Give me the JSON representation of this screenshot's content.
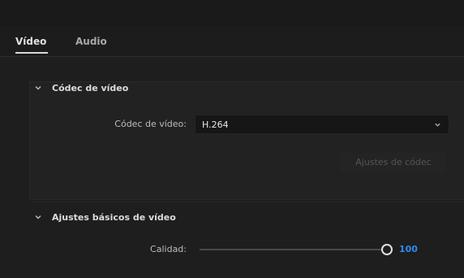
{
  "tabs": [
    {
      "label": "Vídeo",
      "active": true
    },
    {
      "label": "Audio",
      "active": false
    }
  ],
  "codec_section": {
    "title": "Códec de vídeo",
    "field_label": "Códec de vídeo:",
    "field_value": "H.264",
    "settings_button": "Ajustes de códec"
  },
  "basic_section": {
    "title": "Ajustes básicos de vídeo",
    "quality_label": "Calidad:",
    "quality_value": "100",
    "quality_fraction": 1.0
  },
  "colors": {
    "accent": "#2d8ceb",
    "background": "#1e1e1e"
  },
  "icons": [
    "chevron-down-icon",
    "dropdown-arrow-icon",
    "slider-thumb"
  ]
}
